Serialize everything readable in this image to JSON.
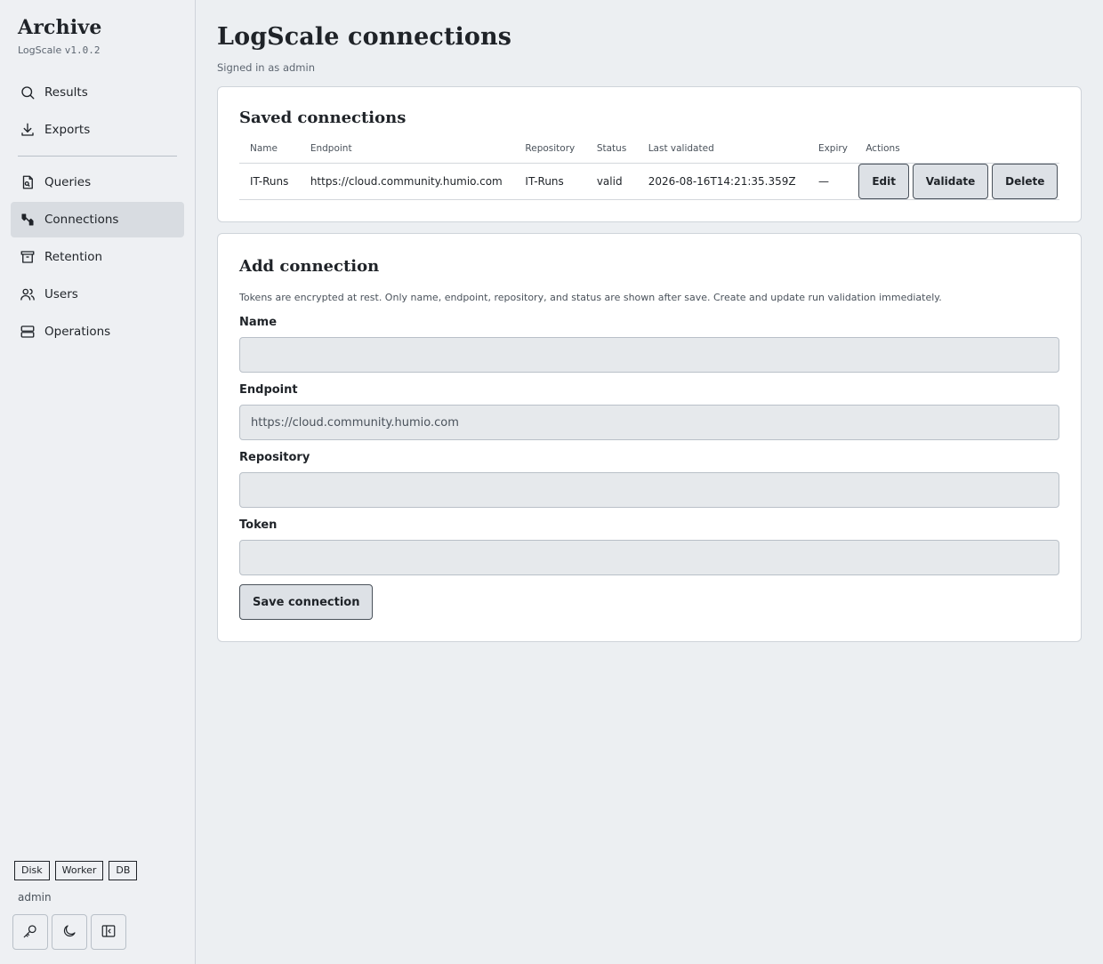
{
  "sidebar": {
    "brand_title": "Archive",
    "brand_name": "LogScale",
    "brand_version": "v1.0.2",
    "nav_primary": [
      {
        "label": "Results",
        "icon": "search-icon"
      },
      {
        "label": "Exports",
        "icon": "download-icon"
      }
    ],
    "nav_secondary": [
      {
        "label": "Queries",
        "icon": "query-file-icon"
      },
      {
        "label": "Connections",
        "icon": "connections-icon",
        "active": true
      },
      {
        "label": "Retention",
        "icon": "archive-box-icon"
      },
      {
        "label": "Users",
        "icon": "users-icon"
      },
      {
        "label": "Operations",
        "icon": "server-icon"
      }
    ],
    "badges": [
      "Disk",
      "Worker",
      "DB"
    ],
    "user": "admin",
    "footer_buttons": [
      "key-icon",
      "moon-icon",
      "collapse-sidebar-icon"
    ]
  },
  "page": {
    "title": "LogScale connections",
    "subtitle": "Signed in as admin"
  },
  "saved": {
    "title": "Saved connections",
    "columns": [
      "Name",
      "Endpoint",
      "Repository",
      "Status",
      "Last validated",
      "Expiry",
      "Actions"
    ],
    "rows": [
      {
        "name": "IT-Runs",
        "endpoint": "https://cloud.community.humio.com",
        "repository": "IT-Runs",
        "status": "valid",
        "last_validated": "2026-08-16T14:21:35.359Z",
        "expiry": "—"
      }
    ],
    "row_actions": [
      "Edit",
      "Validate",
      "Delete"
    ]
  },
  "add": {
    "title": "Add connection",
    "helper": "Tokens are encrypted at rest. Only name, endpoint, repository, and status are shown after save. Create and update run validation immediately.",
    "fields": {
      "name": {
        "label": "Name",
        "value": "",
        "placeholder": ""
      },
      "endpoint": {
        "label": "Endpoint",
        "value": "",
        "placeholder": "https://cloud.community.humio.com"
      },
      "repository": {
        "label": "Repository",
        "value": "",
        "placeholder": ""
      },
      "token": {
        "label": "Token",
        "value": "",
        "placeholder": ""
      }
    },
    "save_label": "Save connection"
  }
}
